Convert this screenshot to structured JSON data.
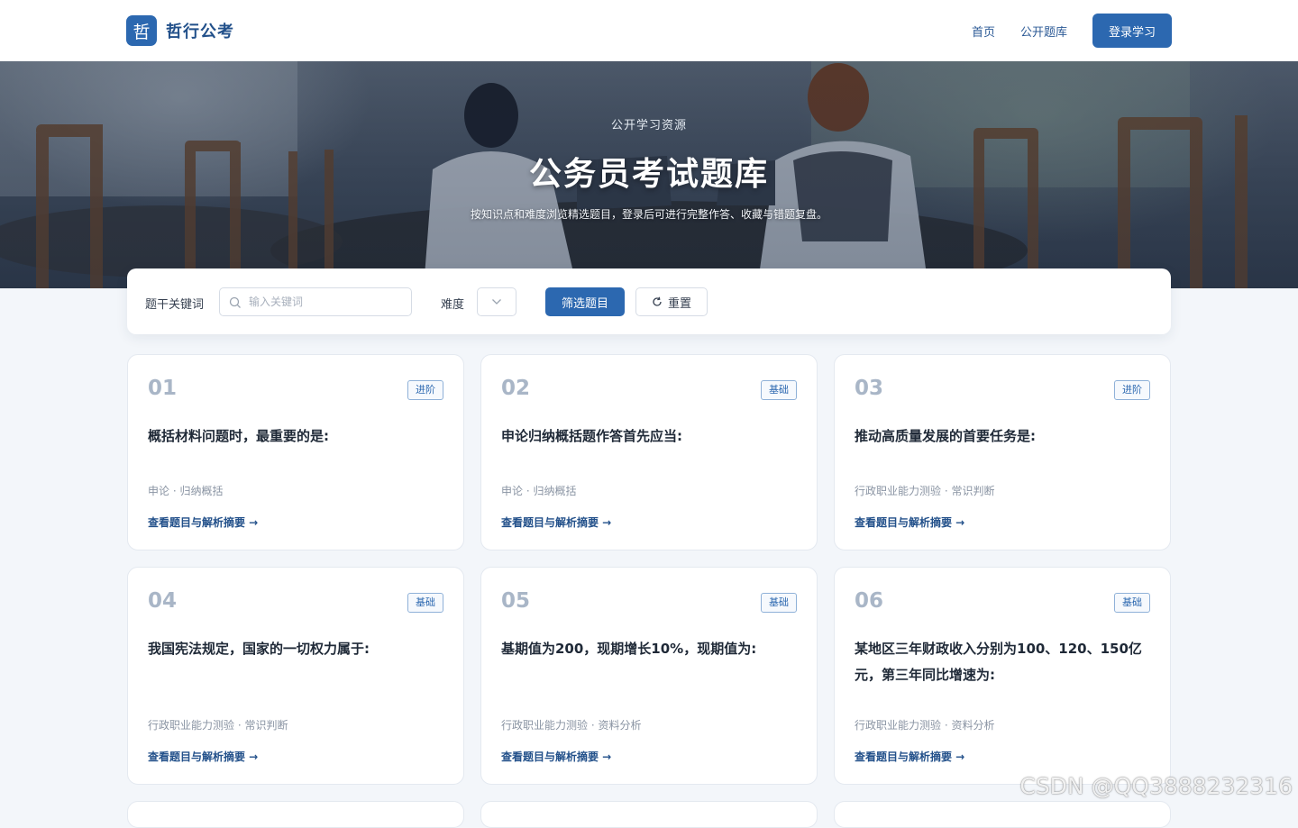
{
  "header": {
    "logo_char": "哲",
    "brand": "哲行公考",
    "nav": [
      "首页",
      "公开题库"
    ],
    "login_label": "登录学习"
  },
  "hero": {
    "kicker": "公开学习资源",
    "title": "公务员考试题库",
    "subtitle": "按知识点和难度浏览精选题目，登录后可进行完整作答、收藏与错题复盘。"
  },
  "filter": {
    "keyword_label": "题干关键词",
    "keyword_placeholder": "输入关键词",
    "difficulty_label": "难度",
    "filter_button": "筛选题目",
    "reset_button": "重置"
  },
  "cards": [
    {
      "num": "01",
      "badge": "进阶",
      "title": "概括材料问题时，最重要的是:",
      "meta": "申论 · 归纳概括",
      "link": "查看题目与解析摘要 →"
    },
    {
      "num": "02",
      "badge": "基础",
      "title": "申论归纳概括题作答首先应当:",
      "meta": "申论 · 归纳概括",
      "link": "查看题目与解析摘要 →"
    },
    {
      "num": "03",
      "badge": "进阶",
      "title": "推动高质量发展的首要任务是:",
      "meta": "行政职业能力测验 · 常识判断",
      "link": "查看题目与解析摘要 →"
    },
    {
      "num": "04",
      "badge": "基础",
      "title": "我国宪法规定，国家的一切权力属于:",
      "meta": "行政职业能力测验 · 常识判断",
      "link": "查看题目与解析摘要 →"
    },
    {
      "num": "05",
      "badge": "基础",
      "title": "基期值为200，现期增长10%，现期值为:",
      "meta": "行政职业能力测验 · 资料分析",
      "link": "查看题目与解析摘要 →"
    },
    {
      "num": "06",
      "badge": "基础",
      "title": "某地区三年财政收入分别为100、120、150亿元，第三年同比增速为:",
      "meta": "行政职业能力测验 · 资料分析",
      "link": "查看题目与解析摘要 →"
    }
  ],
  "watermark": "CSDN @QQ3888232316",
  "colors": {
    "primary": "#2c68b0",
    "brand_text": "#22508a",
    "page_bg": "#f3f6fa",
    "badge_border": "#8fb1d8"
  }
}
